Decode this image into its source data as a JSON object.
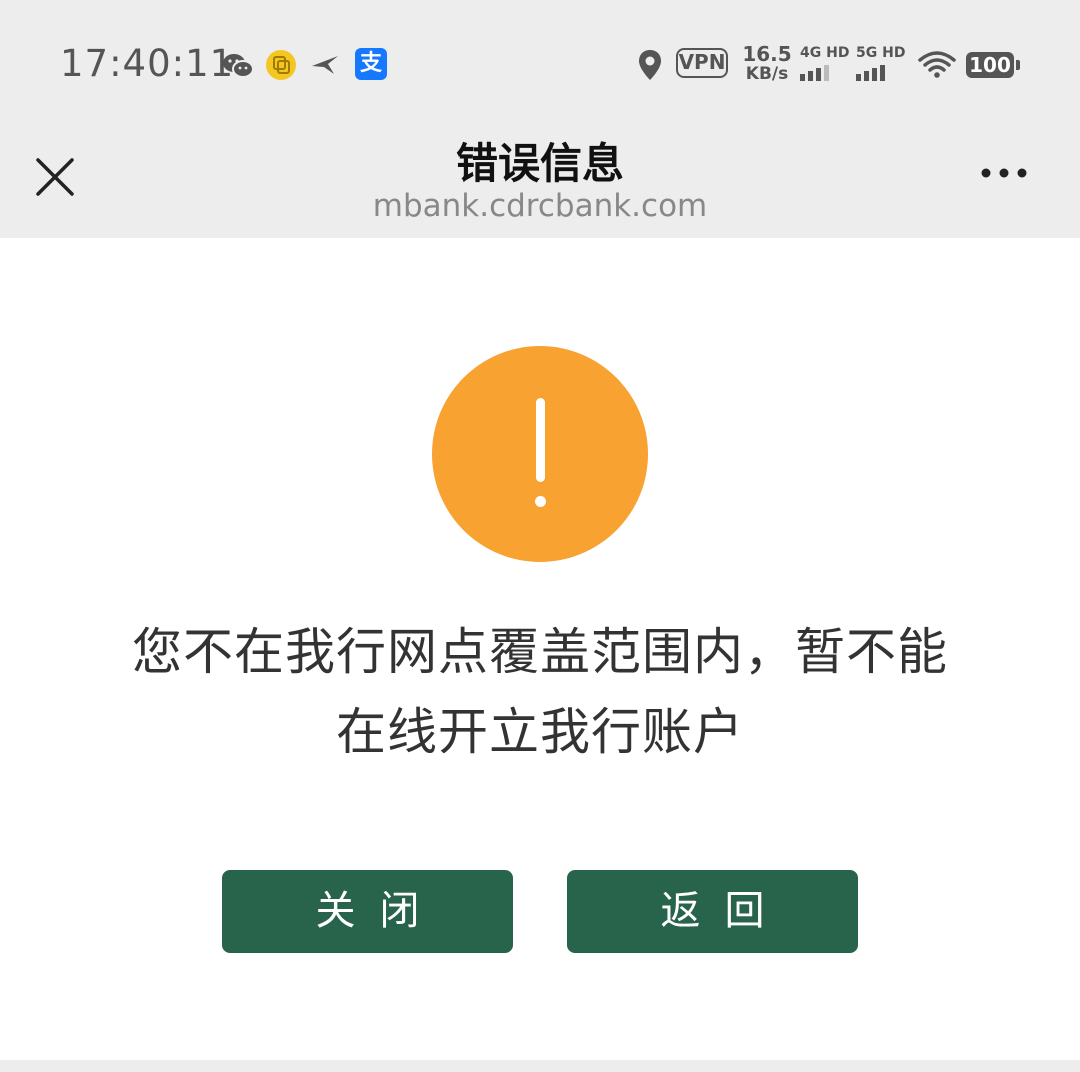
{
  "status_bar": {
    "time": "17:40:11",
    "alipay_glyph": "支",
    "vpn_label": "VPN",
    "speed_value": "16.5",
    "speed_unit": "KB/s",
    "signal_1_label": "4G HD",
    "signal_2_label": "5G HD",
    "battery_level": "100",
    "icons": [
      "wechat-icon",
      "copy-app-icon",
      "bird-app-icon",
      "alipay-icon",
      "location-icon",
      "wifi-icon",
      "battery-icon"
    ]
  },
  "title_bar": {
    "title": "错误信息",
    "url": "mbank.cdrcbank.com",
    "close_icon": "close-icon",
    "more_icon": "more-icon"
  },
  "content": {
    "warning_icon": "exclamation-icon",
    "warning_color": "#f8a232",
    "message_line1": "您不在我行网点覆盖范围内，暂不能",
    "message_line2": "在线开立我行账户"
  },
  "buttons": {
    "close_label": "关闭",
    "back_label": "返回",
    "color": "#28634c"
  }
}
